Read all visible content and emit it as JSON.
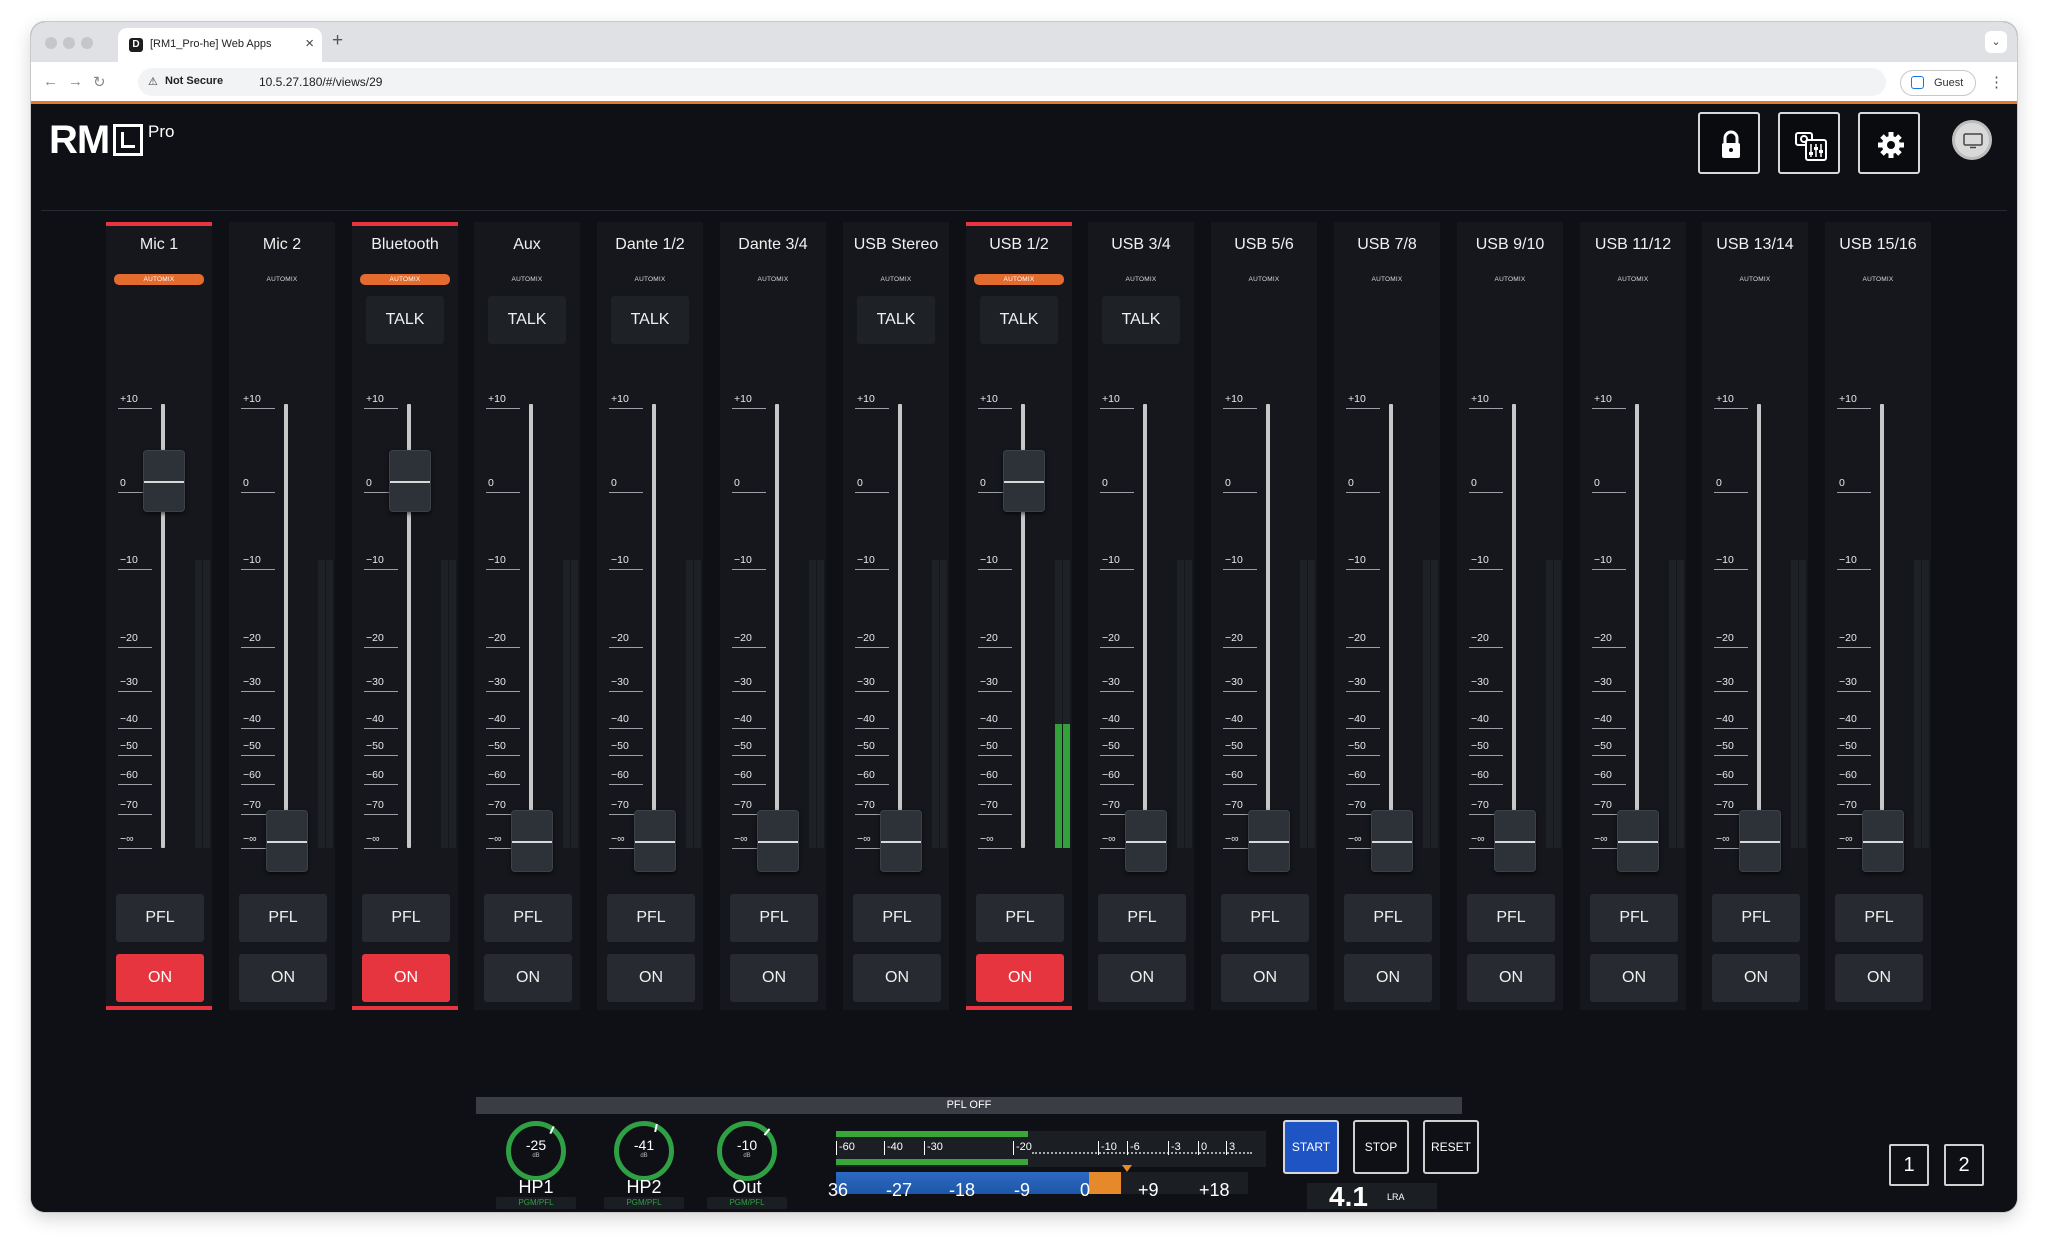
{
  "browser": {
    "tab_title": "[RM1_Pro-he] Web Apps",
    "favicon": "D",
    "not_secure": "Not Secure",
    "url": "10.5.27.180/#/views/29",
    "guest": "Guest"
  },
  "app": {
    "logo_text": "RM",
    "logo_suffix": "Pro",
    "accent_color": "#e73540",
    "meter_color": "#32a13a"
  },
  "scale_labels": [
    "+10",
    "0",
    "−10",
    "−20",
    "−30",
    "−40",
    "−50",
    "−60",
    "−70",
    "−∞"
  ],
  "channels": [
    {
      "name": "Mic 1",
      "automix": "AUTOMIX",
      "automix_active": true,
      "talk": "",
      "fader_db": "0",
      "pfl": "PFL",
      "on": "ON",
      "on_active": true,
      "selected": true,
      "meter_level": 0
    },
    {
      "name": "Mic 2",
      "automix": "AUTOMIX",
      "automix_active": false,
      "talk": "",
      "fader_db": "-inf",
      "pfl": "PFL",
      "on": "ON",
      "on_active": false,
      "selected": false,
      "meter_level": 0
    },
    {
      "name": "Bluetooth",
      "automix": "AUTOMIX",
      "automix_active": true,
      "talk": "TALK",
      "fader_db": "0",
      "pfl": "PFL",
      "on": "ON",
      "on_active": true,
      "selected": true,
      "meter_level": 0
    },
    {
      "name": "Aux",
      "automix": "AUTOMIX",
      "automix_active": false,
      "talk": "TALK",
      "fader_db": "-inf",
      "pfl": "PFL",
      "on": "ON",
      "on_active": false,
      "selected": false,
      "meter_level": 0
    },
    {
      "name": "Dante 1/2",
      "automix": "AUTOMIX",
      "automix_active": false,
      "talk": "TALK",
      "fader_db": "-inf",
      "pfl": "PFL",
      "on": "ON",
      "on_active": false,
      "selected": false,
      "meter_level": 0
    },
    {
      "name": "Dante 3/4",
      "automix": "AUTOMIX",
      "automix_active": false,
      "talk": "",
      "fader_db": "-inf",
      "pfl": "PFL",
      "on": "ON",
      "on_active": false,
      "selected": false,
      "meter_level": 0
    },
    {
      "name": "USB Stereo",
      "automix": "AUTOMIX",
      "automix_active": false,
      "talk": "TALK",
      "fader_db": "-inf",
      "pfl": "PFL",
      "on": "ON",
      "on_active": false,
      "selected": false,
      "meter_level": 0
    },
    {
      "name": "USB 1/2",
      "automix": "AUTOMIX",
      "automix_active": true,
      "talk": "TALK",
      "fader_db": "0",
      "pfl": "PFL",
      "on": "ON",
      "on_active": true,
      "selected": true,
      "meter_level": 0.43
    },
    {
      "name": "USB 3/4",
      "automix": "AUTOMIX",
      "automix_active": false,
      "talk": "TALK",
      "fader_db": "-inf",
      "pfl": "PFL",
      "on": "ON",
      "on_active": false,
      "selected": false,
      "meter_level": 0
    },
    {
      "name": "USB 5/6",
      "automix": "AUTOMIX",
      "automix_active": false,
      "talk": "",
      "fader_db": "-inf",
      "pfl": "PFL",
      "on": "ON",
      "on_active": false,
      "selected": false,
      "meter_level": 0
    },
    {
      "name": "USB 7/8",
      "automix": "AUTOMIX",
      "automix_active": false,
      "talk": "",
      "fader_db": "-inf",
      "pfl": "PFL",
      "on": "ON",
      "on_active": false,
      "selected": false,
      "meter_level": 0
    },
    {
      "name": "USB 9/10",
      "automix": "AUTOMIX",
      "automix_active": false,
      "talk": "",
      "fader_db": "-inf",
      "pfl": "PFL",
      "on": "ON",
      "on_active": false,
      "selected": false,
      "meter_level": 0
    },
    {
      "name": "USB 11/12",
      "automix": "AUTOMIX",
      "automix_active": false,
      "talk": "",
      "fader_db": "-inf",
      "pfl": "PFL",
      "on": "ON",
      "on_active": false,
      "selected": false,
      "meter_level": 0
    },
    {
      "name": "USB 13/14",
      "automix": "AUTOMIX",
      "automix_active": false,
      "talk": "",
      "fader_db": "-inf",
      "pfl": "PFL",
      "on": "ON",
      "on_active": false,
      "selected": false,
      "meter_level": 0
    },
    {
      "name": "USB 15/16",
      "automix": "AUTOMIX",
      "automix_active": false,
      "talk": "",
      "fader_db": "-inf",
      "pfl": "PFL",
      "on": "ON",
      "on_active": false,
      "selected": false,
      "meter_level": 0
    }
  ],
  "monitor": {
    "status": "PFL OFF",
    "knobs": [
      {
        "value": "-25",
        "unit": "dB",
        "label": "HP1",
        "tag": "PGM/PFL"
      },
      {
        "value": "-41",
        "unit": "dB",
        "label": "HP2",
        "tag": "PGM/PFL"
      },
      {
        "value": "-10",
        "unit": "dB",
        "label": "Out",
        "tag": "PGM/PFL"
      }
    ],
    "upper_scale": [
      "-60",
      "-40",
      "-30",
      "-20",
      "-10",
      "-6",
      "-3",
      "0",
      "3"
    ],
    "lower_scale": [
      "36",
      "-27",
      "-18",
      "-9",
      "0",
      "+9",
      "+18"
    ],
    "buttons": {
      "start": "START",
      "stop": "STOP",
      "reset": "RESET"
    },
    "lra_value": "4.1",
    "lra_unit": "LRA"
  },
  "pages": [
    "1",
    "2"
  ]
}
